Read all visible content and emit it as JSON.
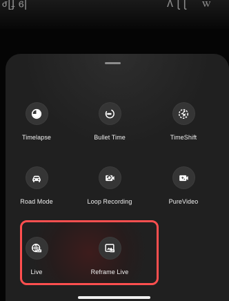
{
  "top_fragment": {
    "left": "ꮷ[ɟ ꮾ|",
    "middle": "ᴧ ɭ ɭ",
    "right": "ꮃ"
  },
  "sheet": {
    "items": [
      {
        "label": "Timelapse",
        "icon": "timelapse-icon"
      },
      {
        "label": "Bullet Time",
        "icon": "bullet-time-icon"
      },
      {
        "label": "TimeShift",
        "icon": "timeshift-icon"
      },
      {
        "label": "Road Mode",
        "icon": "road-mode-icon"
      },
      {
        "label": "Loop Recording",
        "icon": "loop-recording-icon"
      },
      {
        "label": "PureVideo",
        "icon": "purevideo-icon"
      },
      {
        "label": "Live",
        "icon": "live-icon"
      },
      {
        "label": "Reframe Live",
        "icon": "reframe-live-icon"
      }
    ],
    "highlight_color": "#ff4f4f"
  }
}
